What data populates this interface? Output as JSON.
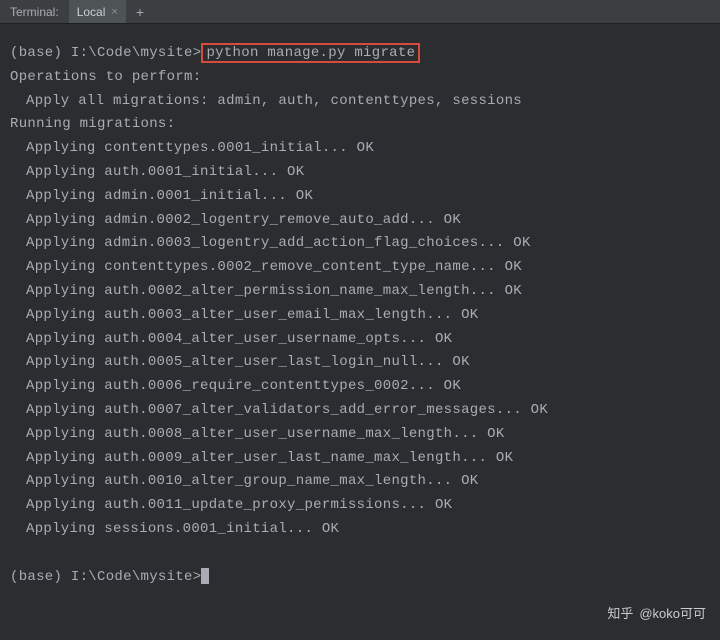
{
  "tabbar": {
    "title": "Terminal:",
    "tab_name": "Local",
    "close_glyph": "×",
    "add_glyph": "+"
  },
  "prompt_prefix": "(base) I:\\Code\\mysite>",
  "highlighted_command": "python manage.py migrate",
  "lines": {
    "ops_header": "Operations to perform:",
    "apply_all": "Apply all migrations: admin, auth, contenttypes, sessions",
    "running_header": "Running migrations:",
    "m1": "Applying contenttypes.0001_initial... OK",
    "m2": "Applying auth.0001_initial... OK",
    "m3": "Applying admin.0001_initial... OK",
    "m4": "Applying admin.0002_logentry_remove_auto_add... OK",
    "m5": "Applying admin.0003_logentry_add_action_flag_choices... OK",
    "m6": "Applying contenttypes.0002_remove_content_type_name... OK",
    "m7": "Applying auth.0002_alter_permission_name_max_length... OK",
    "m8": "Applying auth.0003_alter_user_email_max_length... OK",
    "m9": "Applying auth.0004_alter_user_username_opts... OK",
    "m10": "Applying auth.0005_alter_user_last_login_null... OK",
    "m11": "Applying auth.0006_require_contenttypes_0002... OK",
    "m12": "Applying auth.0007_alter_validators_add_error_messages... OK",
    "m13": "Applying auth.0008_alter_user_username_max_length... OK",
    "m14": "Applying auth.0009_alter_user_last_name_max_length... OK",
    "m15": "Applying auth.0010_alter_group_name_max_length... OK",
    "m16": "Applying auth.0011_update_proxy_permissions... OK",
    "m17": "Applying sessions.0001_initial... OK"
  },
  "watermark": {
    "brand": "知乎",
    "handle": "@koko可可"
  }
}
